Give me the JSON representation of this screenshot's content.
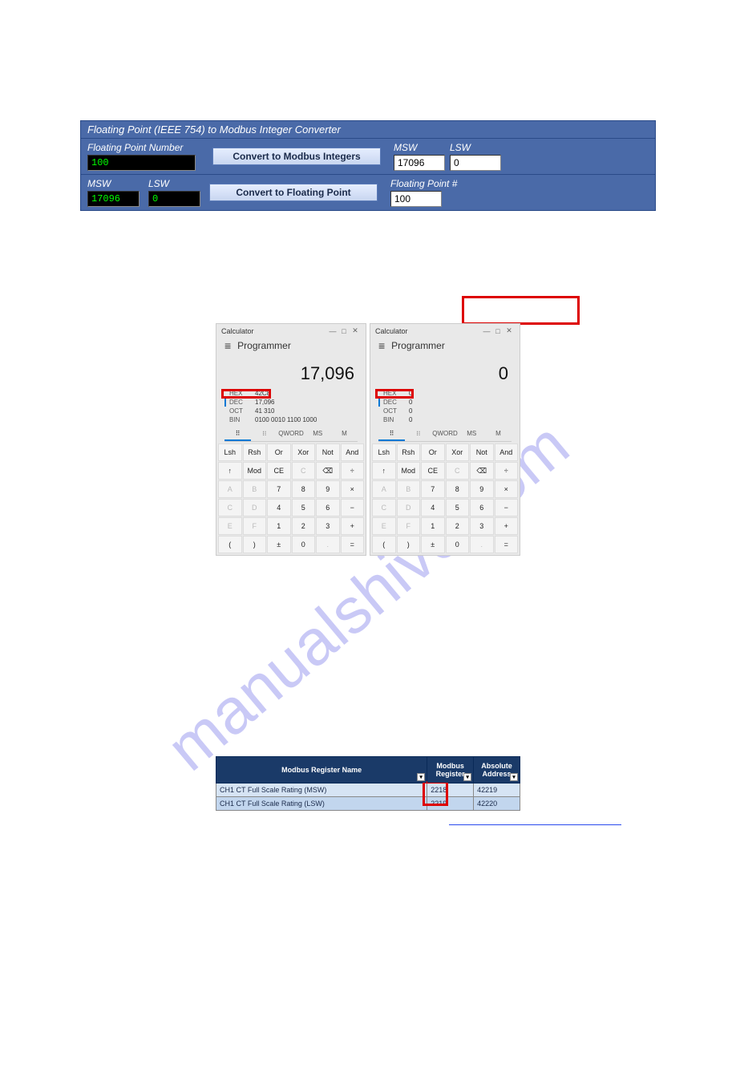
{
  "watermark": "manualshive.com",
  "converter": {
    "title": "Floating Point (IEEE 754) to Modbus Integer Converter",
    "fp_label": "Floating Point Number",
    "fp_value": "100",
    "to_int_btn": "Convert to Modbus Integers",
    "msw_label": "MSW",
    "lsw_label": "LSW",
    "out_msw": "17096",
    "out_lsw": "0",
    "in_msw": "17096",
    "in_lsw": "0",
    "to_float_btn": "Convert to Floating Point",
    "fp_out_label": "Floating Point #",
    "fp_out": "100"
  },
  "calc_left": {
    "title": "Calculator",
    "mode": "Programmer",
    "display": "17,096",
    "hex": "42C8",
    "dec": "17,096",
    "oct": "41 310",
    "bin": "0100 0010 1100 1000"
  },
  "calc_right": {
    "title": "Calculator",
    "mode": "Programmer",
    "display": "0",
    "hex": "0",
    "dec": "0",
    "oct": "0",
    "bin": "0"
  },
  "calc_common": {
    "hex_lbl": "HEX",
    "dec_lbl": "DEC",
    "oct_lbl": "OCT",
    "bin_lbl": "BIN",
    "tab_qword": "QWORD",
    "tab_ms": "MS",
    "row1": [
      "Lsh",
      "Rsh",
      "Or",
      "Xor",
      "Not",
      "And"
    ],
    "row2": [
      "↑",
      "Mod",
      "CE",
      "C",
      "⌫",
      "÷"
    ],
    "row3": [
      "A",
      "B",
      "7",
      "8",
      "9",
      "×"
    ],
    "row4": [
      "C",
      "D",
      "4",
      "5",
      "6",
      "−"
    ],
    "row5": [
      "E",
      "F",
      "1",
      "2",
      "3",
      "+"
    ],
    "row6": [
      "(",
      ")",
      "±",
      "0",
      ".",
      "="
    ]
  },
  "regtable": {
    "h1": "Modbus Register Name",
    "h2": "Modbus Register",
    "h3": "Absolute Address",
    "rows": [
      {
        "name": "CH1 CT Full Scale Rating (MSW)",
        "reg": "2218",
        "addr": "42219"
      },
      {
        "name": "CH1 CT Full Scale Rating (LSW)",
        "reg": "2219",
        "addr": "42220"
      }
    ]
  }
}
